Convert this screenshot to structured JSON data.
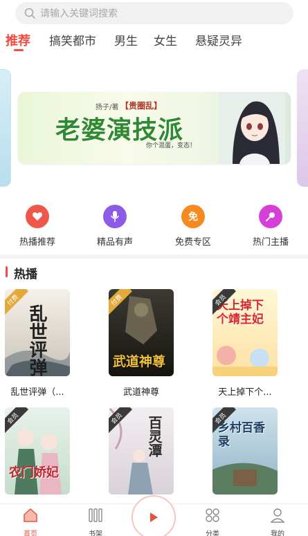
{
  "search": {
    "placeholder": "请输入关键词搜索"
  },
  "tabs": [
    {
      "label": "推荐",
      "active": true
    },
    {
      "label": "搞笑都市",
      "active": false
    },
    {
      "label": "男生",
      "active": false
    },
    {
      "label": "女生",
      "active": false
    },
    {
      "label": "悬疑灵异",
      "active": false
    }
  ],
  "banner": {
    "author": "扬子/著",
    "tag": "【贵圈乱】",
    "title": "老婆演技派",
    "tagline": "你个混蛋，变态！"
  },
  "categories": [
    {
      "label": "热播推荐",
      "icon": "heart-icon",
      "color": "#f0574b"
    },
    {
      "label": "精品有声",
      "icon": "microphone-icon",
      "color": "#8d5be8"
    },
    {
      "label": "免费专区",
      "icon": "free-icon",
      "icon_text": "免",
      "color": "#f6891f"
    },
    {
      "label": "热门主播",
      "icon": "anchor-mic-icon",
      "color": "#d63fd8"
    }
  ],
  "section": {
    "title": "热播"
  },
  "books": [
    {
      "title": "乱世评弹（...",
      "badge": "付费",
      "cover_text": "乱世评弹"
    },
    {
      "title": "武道神尊",
      "badge": "付费",
      "cover_text": "武道神尊"
    },
    {
      "title": "天上掉下个...",
      "badge": "会员",
      "cover_text": "天上掉下个靖主妃"
    },
    {
      "title": "",
      "badge": "会员",
      "cover_text": "农门娇妃"
    },
    {
      "title": "",
      "badge": "会员",
      "cover_text": "百灵潭"
    },
    {
      "title": "",
      "badge": "会员",
      "cover_text": "乡村百香录"
    }
  ],
  "bottom_nav": [
    {
      "label": "首页",
      "icon": "home-icon",
      "active": true
    },
    {
      "label": "书架",
      "icon": "bookshelf-icon",
      "active": false
    },
    {
      "label": "分类",
      "icon": "category-icon",
      "active": false
    },
    {
      "label": "我的",
      "icon": "profile-icon",
      "active": false
    }
  ],
  "colors": {
    "accent": "#f04b3c"
  }
}
